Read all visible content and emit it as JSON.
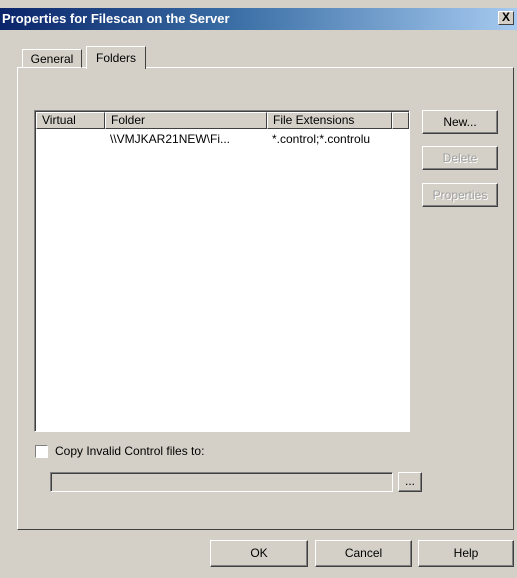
{
  "window": {
    "title": "Properties for Filescan on the Server",
    "close_label": "X"
  },
  "tabs": [
    {
      "label": "General"
    },
    {
      "label": "Folders"
    }
  ],
  "list": {
    "columns": [
      "Virtual",
      "Folder",
      "File Extensions"
    ],
    "rows": [
      {
        "virtual": "",
        "folder": "\\\\VMJKAR21NEW\\Fi...",
        "extensions": "*.control;*.controlu"
      }
    ]
  },
  "side_buttons": {
    "new": "New...",
    "delete": "Delete",
    "properties": "Properties"
  },
  "copy_invalid": {
    "label": "Copy Invalid Control files to:",
    "checked": false,
    "path_value": "",
    "browse_label": "..."
  },
  "footer_buttons": {
    "ok": "OK",
    "cancel": "Cancel",
    "help": "Help"
  }
}
